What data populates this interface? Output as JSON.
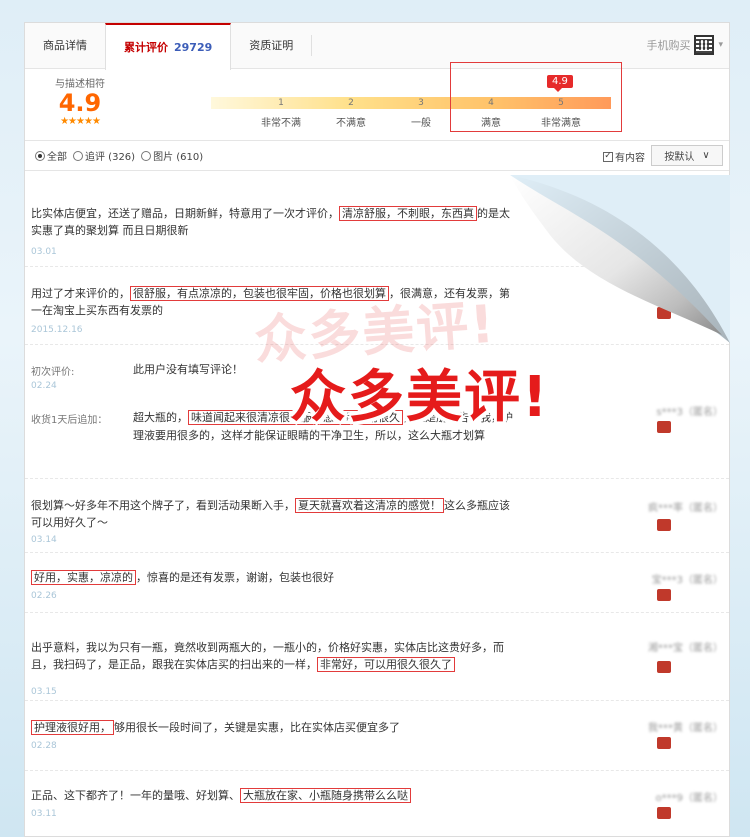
{
  "tabs": [
    {
      "label": "商品详情"
    },
    {
      "label": "累计评价",
      "count": "29729"
    },
    {
      "label": "资质证明"
    }
  ],
  "mobile_buy": {
    "label": "手机购买",
    "caret": "▾"
  },
  "score": {
    "label": "与描述相符",
    "value": "4.9",
    "stars": "★★★★★",
    "marker": "4.9",
    "ticks": [
      "1",
      "2",
      "3",
      "4",
      "5"
    ],
    "tick_labels": [
      "非常不满",
      "不满意",
      "一般",
      "满意",
      "非常满意"
    ]
  },
  "filters": {
    "all": "全部",
    "followup": "追评 (326)",
    "images": "图片 (610)",
    "with_content": "有内容",
    "with_content_check": "✓",
    "sort": "按默认",
    "sort_caret": "∨"
  },
  "reviews": [
    {
      "pre": "比实体店便宜，还送了赠品，日期新鲜，特意用了一次才评价，",
      "hl": "清凉舒服，不刺眼，东西真",
      "post": "的是太实惠了真的聚划算 而且日期很新",
      "date": "03.01",
      "user": "3***b（匿名）"
    },
    {
      "pre": "用过了才来评价的，",
      "hl": "很舒服，有点凉凉的，包装也很牢固，价格也很划算",
      "post": "，很满意，还有发票，第一在淘宝上买东西有发票的",
      "date": "2015.12.16",
      "user": ""
    },
    {
      "first_label": "初次评价:",
      "first_body": "此用户没有填写评论！",
      "first_date": "02.24",
      "append_label": "收货1天后追加：",
      "pre": "超大瓶的，",
      "hl": "味道闻起来很清凉很舒服，感觉可以用很久",
      "post": "，但是朋友告诉我，护理液要用很多的，这样才能保证眼睛的干净卫生，所以，这么大瓶才划算",
      "user": "s***3（匿名）"
    },
    {
      "pre": "很划算～好多年不用这个牌子了，看到活动果断入手，",
      "hl": "夏天就喜欢着这清凉的感觉！",
      "post": "这么多瓶应该可以用好久了～",
      "date": "03.14",
      "user": "疯***率（匿名）"
    },
    {
      "pre": "",
      "hl": "好用，实惠，凉凉的",
      "post": "，惊喜的是还有发票，谢谢，包装也很好",
      "date": "02.26",
      "user": "宝***3（匿名）"
    },
    {
      "pre": "出乎意料，我以为只有一瓶，竟然收到两瓶大的，一瓶小的，价格好实惠，实体店比这贵好多，而且，我扫码了，是正品，跟我在实体店买的扫出来的一样，",
      "hl": "非常好，可以用很久很久了",
      "post": "",
      "date": "03.15",
      "user": "湘***宝（匿名）"
    },
    {
      "pre": "",
      "hl": "护理液很好用，",
      "post": "够用很长一段时间了，关键是实惠，比在实体店买便宜多了",
      "date": "02.28",
      "user": "我***黄（匿名）"
    },
    {
      "pre": "正品、这下都齐了！一年的量哦、好划算、",
      "hl": "大瓶放在家、小瓶随身携带么么哒",
      "post": "",
      "date": "03.11",
      "user": "o***9（匿名）"
    }
  ],
  "stamp": {
    "text": "众多美评!",
    "ghost": "众多美评!"
  },
  "colors": {
    "accent": "#c40000",
    "score": "#ff6600",
    "highlight": "#e23b3b",
    "count": "#3c5db8"
  }
}
